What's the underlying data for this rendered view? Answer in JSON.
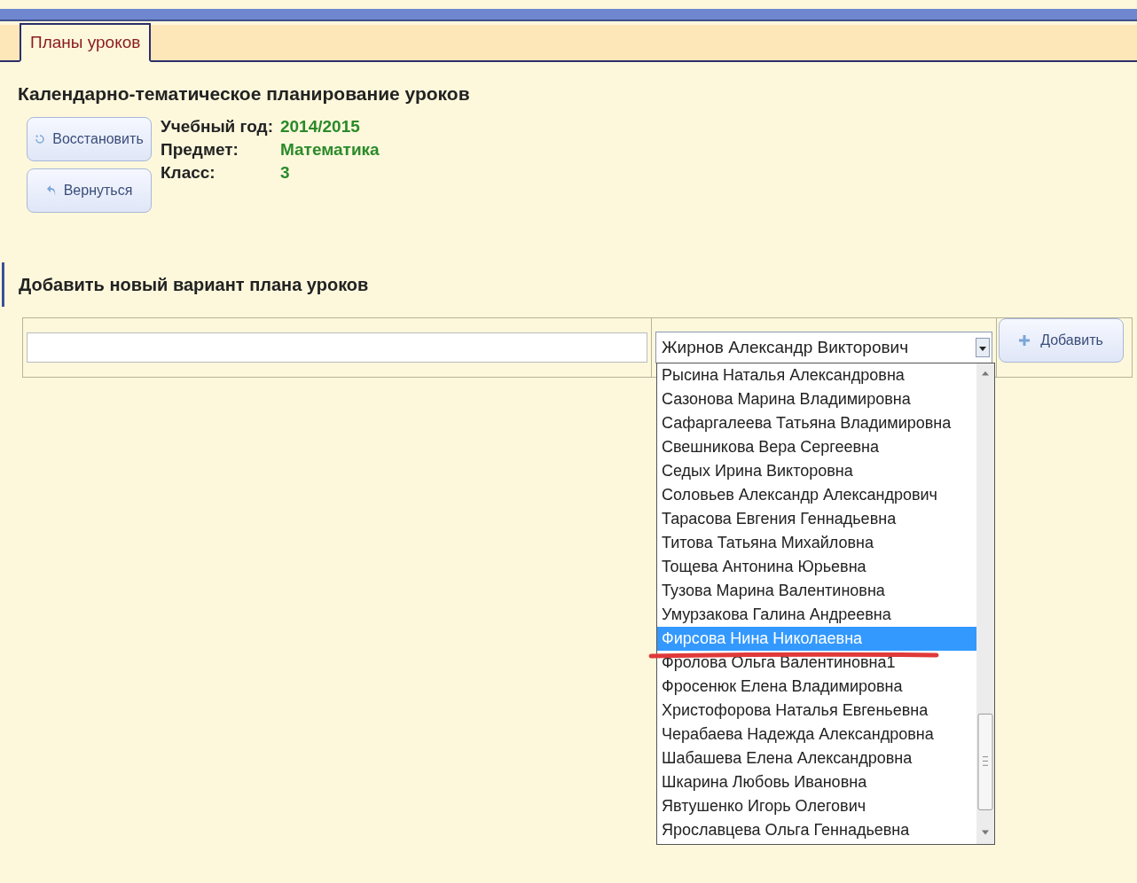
{
  "tabs": [
    {
      "label": "Планы уроков",
      "selected": true
    }
  ],
  "heading": "Календарно-тематическое планирование уроков",
  "buttons": [
    {
      "kind": "restore",
      "label": "Восстановить"
    },
    {
      "kind": "back",
      "label": "Вернуться"
    }
  ],
  "info": [
    {
      "label": "Учебный год:",
      "value": "2014/2015"
    },
    {
      "label": "Предмет:",
      "value": "Математика"
    },
    {
      "label": "Класс:",
      "value": "3"
    }
  ],
  "add_section": {
    "title": "Добавить новый вариант плана уроков",
    "teacher_select": {
      "value": "Жирнов Александр Викторович"
    },
    "add_button": "Добавить"
  },
  "dropdown": [
    {
      "label": "Рысина Наталья Александровна",
      "selected": false
    },
    {
      "label": "Сазонова Марина Владимировна",
      "selected": false
    },
    {
      "label": "Сафаргалеева Татьяна Владимировна",
      "selected": false
    },
    {
      "label": "Свешникова Вера Сергеевна",
      "selected": false
    },
    {
      "label": "Седых Ирина Викторовна",
      "selected": false
    },
    {
      "label": "Соловьев Александр Александрович",
      "selected": false
    },
    {
      "label": "Тарасова Евгения Геннадьевна",
      "selected": false
    },
    {
      "label": "Титова Татьяна Михайловна",
      "selected": false
    },
    {
      "label": "Тощева Антонина Юрьевна",
      "selected": false
    },
    {
      "label": "Тузова Марина Валентиновна",
      "selected": false
    },
    {
      "label": "Умурзакова Галина Андреевна",
      "selected": false
    },
    {
      "label": "Фирсова Нина Николаевна",
      "selected": true
    },
    {
      "label": "Фролова Ольга Валентиновна1",
      "selected": false
    },
    {
      "label": "Фросенюк Елена Владимировна",
      "selected": false
    },
    {
      "label": "Христофорова Наталья Евгеньевна",
      "selected": false
    },
    {
      "label": "Черабаева Надежда Александровна",
      "selected": false
    },
    {
      "label": "Шабашева Елена Александровна",
      "selected": false
    },
    {
      "label": "Шкарина Любовь Ивановна",
      "selected": false
    },
    {
      "label": "Явтушенко Игорь Олегович",
      "selected": false
    },
    {
      "label": "Ярославцева Ольга Геннадьевна",
      "selected": false
    }
  ]
}
